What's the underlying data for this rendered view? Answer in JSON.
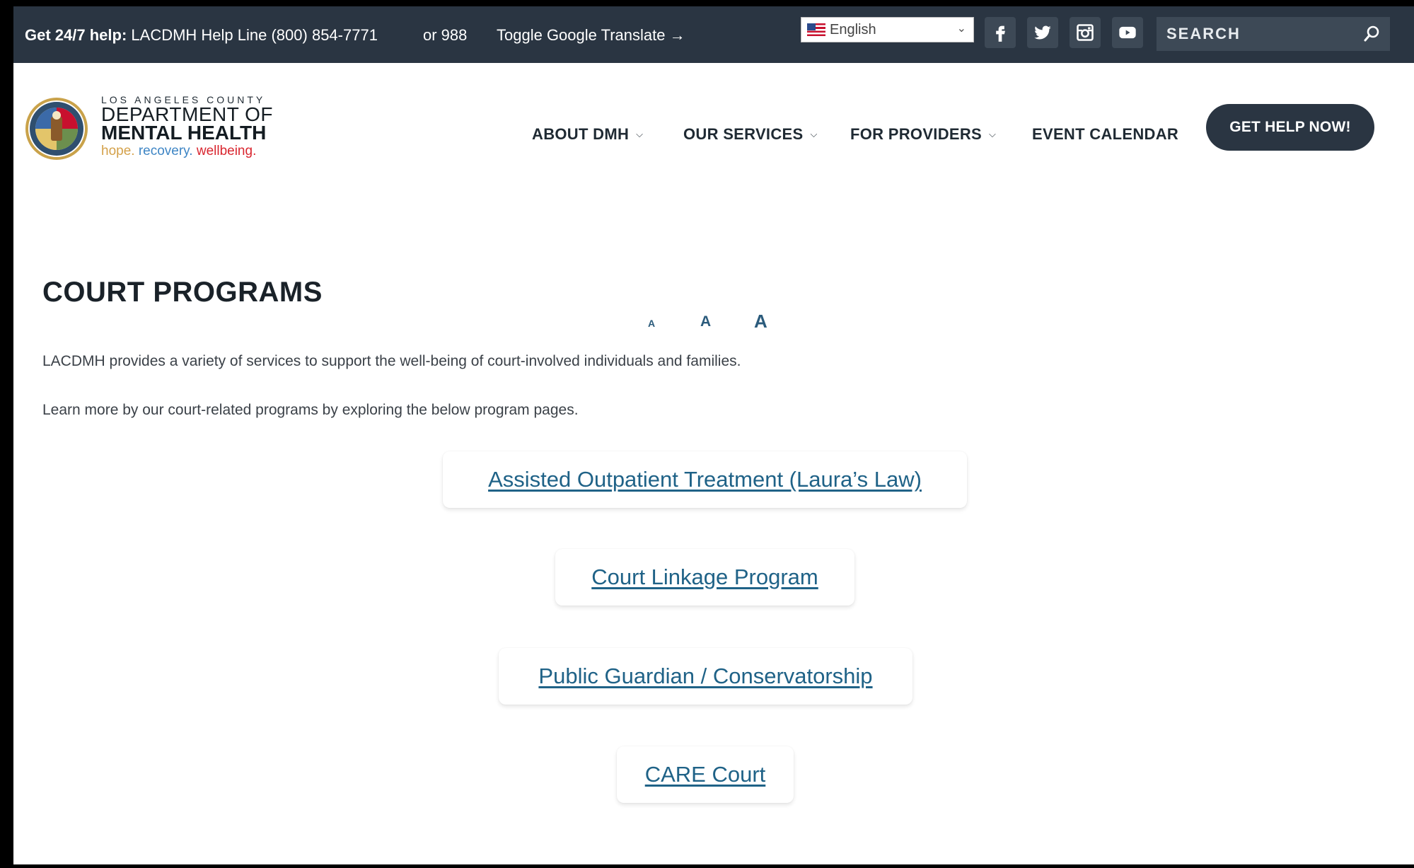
{
  "topbar": {
    "help_bold": "Get 24/7 help:",
    "help_line": "LACDMH Help Line (800) 854-7771",
    "or_988": "or 988",
    "translate": "Toggle Google Translate →",
    "language": "English",
    "search_placeholder": "SEARCH",
    "social": [
      "facebook-icon",
      "twitter-icon",
      "instagram-icon",
      "youtube-icon"
    ]
  },
  "header": {
    "logo_county": "LOS ANGELES COUNTY",
    "logo_dept": "DEPARTMENT OF",
    "logo_dept2": "MENTAL HEALTH",
    "tag_hope": "hope.",
    "tag_recovery": "recovery.",
    "tag_wellbeing": "wellbeing.",
    "nav": [
      "ABOUT DMH",
      "OUR SERVICES",
      "FOR PROVIDERS",
      "EVENT CALENDAR"
    ],
    "cta": "GET HELP NOW!"
  },
  "main": {
    "title": "COURT PROGRAMS",
    "font_sizes": [
      "A",
      "A",
      "A"
    ],
    "intro": "LACDMH provides a variety of services to support the well-being of court-involved individuals and families.",
    "learn_more": "Learn more by our court-related programs by exploring the below program pages.",
    "programs": [
      "Assisted Outpatient Treatment (Laura’s Law)",
      "Court Linkage Program",
      "Public Guardian / Conservatorship",
      "CARE Court"
    ]
  },
  "colors": {
    "topbar_bg": "#2a3542",
    "link": "#1f6287",
    "accent_blue": "#2b5b7c"
  }
}
